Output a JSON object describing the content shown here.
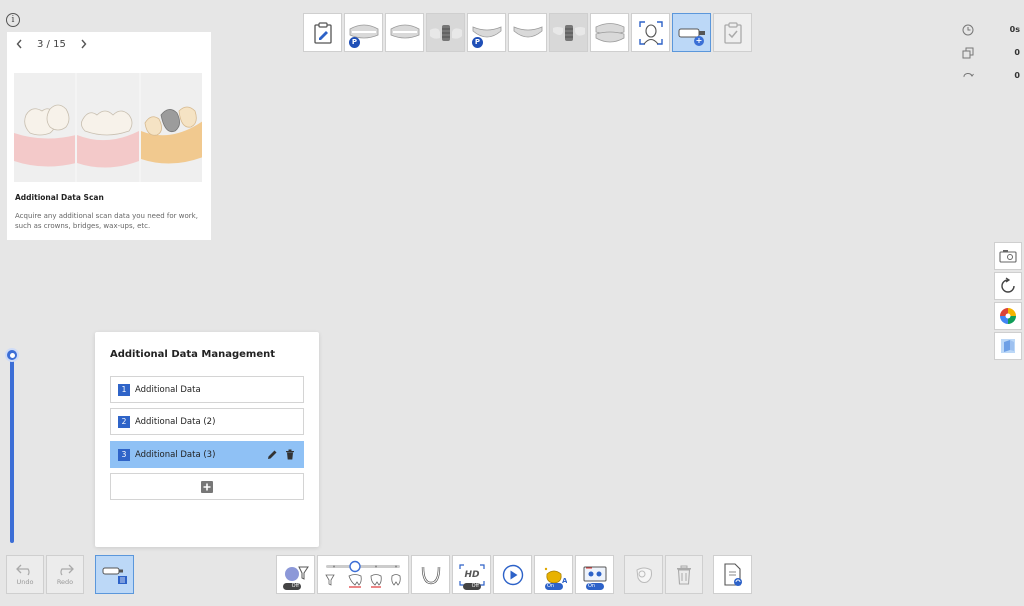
{
  "info_icon": "info-icon",
  "guide": {
    "page": "3 / 15",
    "title": "Additional Data Scan",
    "description": "Acquire any additional scan data you need for work, such as crowns, bridges, wax-ups, etc."
  },
  "top_toolbar": {
    "items": [
      {
        "name": "clipboard-edit-icon",
        "state": "normal"
      },
      {
        "name": "maxilla-prep-icon",
        "badge": "P"
      },
      {
        "name": "maxilla-icon"
      },
      {
        "name": "scanbody-upper-icon",
        "state": "gray"
      },
      {
        "name": "mandible-prep-icon",
        "badge": "P"
      },
      {
        "name": "mandible-icon"
      },
      {
        "name": "scanbody-lower-icon",
        "state": "gray"
      },
      {
        "name": "occlusion-icon"
      },
      {
        "name": "face-scan-icon"
      },
      {
        "name": "additional-data-icon",
        "state": "active"
      },
      {
        "name": "checklist-icon",
        "state": "disabled"
      }
    ]
  },
  "stats": {
    "time": "0s",
    "copies": "0",
    "rotations": "0"
  },
  "mgmt": {
    "title": "Additional Data Management",
    "items": [
      {
        "num": "1",
        "label": "Additional Data"
      },
      {
        "num": "2",
        "label": "Additional Data (2)"
      },
      {
        "num": "3",
        "label": "Additional Data (3)"
      }
    ]
  },
  "bottom": {
    "undo": "Undo",
    "redo": "Redo",
    "filter_toggle": "Off",
    "hd_toggle": "Off",
    "ai_toggle": "On",
    "view_toggle": "On"
  },
  "colors": {
    "accent": "#3c6ed6",
    "selected": "#8fc1f5",
    "active_tool": "#bcd8f7"
  }
}
